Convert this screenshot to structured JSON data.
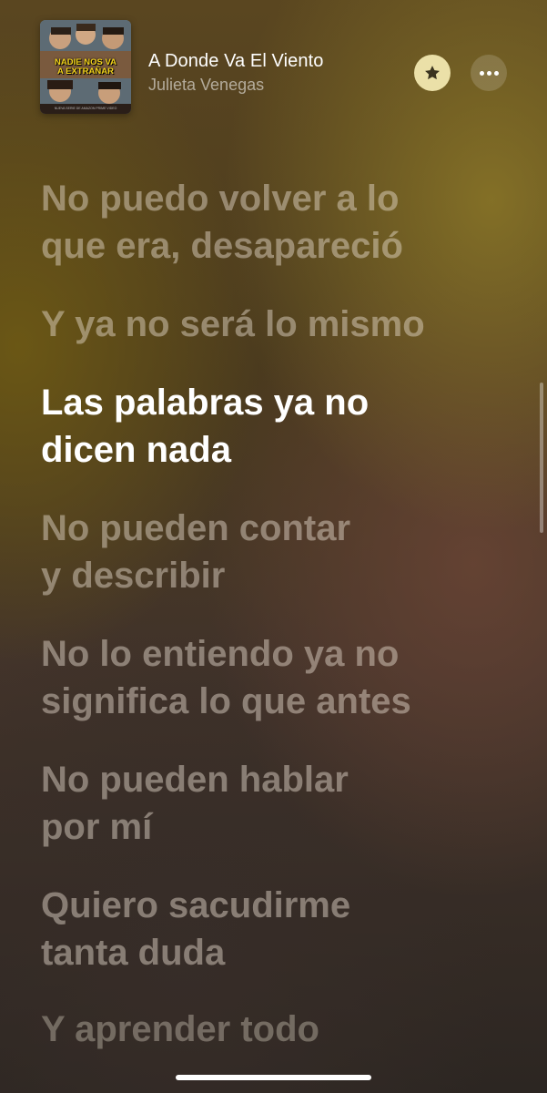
{
  "now_playing": {
    "title": "A Donde Va El Viento",
    "artist": "Julieta Venegas",
    "album_art": {
      "title": "NADIE NOS VA\nA EXTRAÑAR",
      "caption": "NUEVA SERIE DE AMAZON PRIME VIDEO"
    }
  },
  "controls": {
    "favorite_icon": "star-icon",
    "more_icon": "ellipsis-icon"
  },
  "lyrics": {
    "current_index": 2,
    "lines": [
      "No puedo volver a lo\nque era, desapareció",
      "Y ya no será lo mismo",
      "Las palabras ya no\ndicen nada",
      "No pueden contar\ny describir",
      "No lo entiendo ya no\nsignifica lo que antes",
      "No pueden hablar\npor mí",
      "Quiero sacudirme\ntanta duda",
      "Y aprender todo"
    ]
  },
  "colors": {
    "accent_star_bg": "#f5ebb4",
    "current_line": "#ffffff",
    "inactive_line": "rgba(235,225,210,0.45)"
  }
}
